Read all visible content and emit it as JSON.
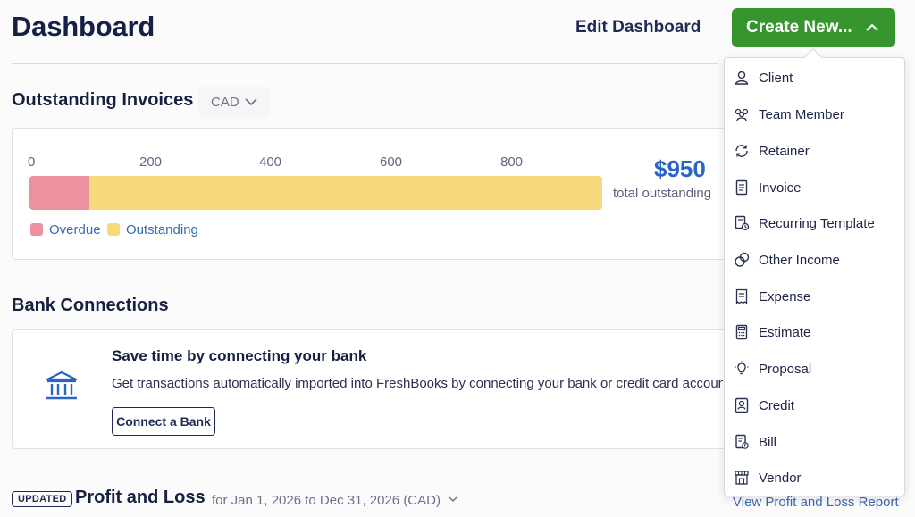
{
  "header": {
    "title": "Dashboard",
    "edit_label": "Edit Dashboard",
    "create_label": "Create New..."
  },
  "invoices": {
    "title": "Outstanding Invoices",
    "currency": "CAD",
    "total_amount": "$950",
    "total_label": "total outstanding",
    "legend": [
      {
        "label": "Overdue",
        "color": "#ec919d"
      },
      {
        "label": "Outstanding",
        "color": "#f8d97c"
      }
    ]
  },
  "chart_data": {
    "type": "bar",
    "orientation": "horizontal-stacked",
    "categories": [
      "Outstanding Invoices"
    ],
    "series": [
      {
        "name": "Overdue",
        "values": [
          100
        ],
        "color": "#ec919d"
      },
      {
        "name": "Outstanding",
        "values": [
          850
        ],
        "color": "#f8d97c"
      }
    ],
    "xticks": [
      "0",
      "200",
      "400",
      "600",
      "800"
    ],
    "xlim": [
      0,
      950
    ]
  },
  "bank": {
    "title": "Bank Connections",
    "heading": "Save time by connecting your bank",
    "description": "Get transactions automatically imported into FreshBooks by connecting your bank or credit card accoun",
    "button_label": "Connect a Bank"
  },
  "pl": {
    "badge": "UPDATED",
    "title": "Profit and Loss",
    "range": "for Jan 1, 2026 to Dec 31, 2026 (CAD)",
    "view_link": "View Profit and Loss Report"
  },
  "menu": {
    "items": [
      {
        "label": "Client",
        "icon": "client-icon"
      },
      {
        "label": "Team Member",
        "icon": "team-member-icon"
      },
      {
        "label": "Retainer",
        "icon": "retainer-icon"
      },
      {
        "label": "Invoice",
        "icon": "invoice-icon"
      },
      {
        "label": "Recurring Template",
        "icon": "recurring-template-icon"
      },
      {
        "label": "Other Income",
        "icon": "other-income-icon"
      },
      {
        "label": "Expense",
        "icon": "expense-icon"
      },
      {
        "label": "Estimate",
        "icon": "estimate-icon"
      },
      {
        "label": "Proposal",
        "icon": "proposal-icon"
      },
      {
        "label": "Credit",
        "icon": "credit-icon"
      },
      {
        "label": "Bill",
        "icon": "bill-icon"
      },
      {
        "label": "Vendor",
        "icon": "vendor-icon"
      }
    ]
  }
}
